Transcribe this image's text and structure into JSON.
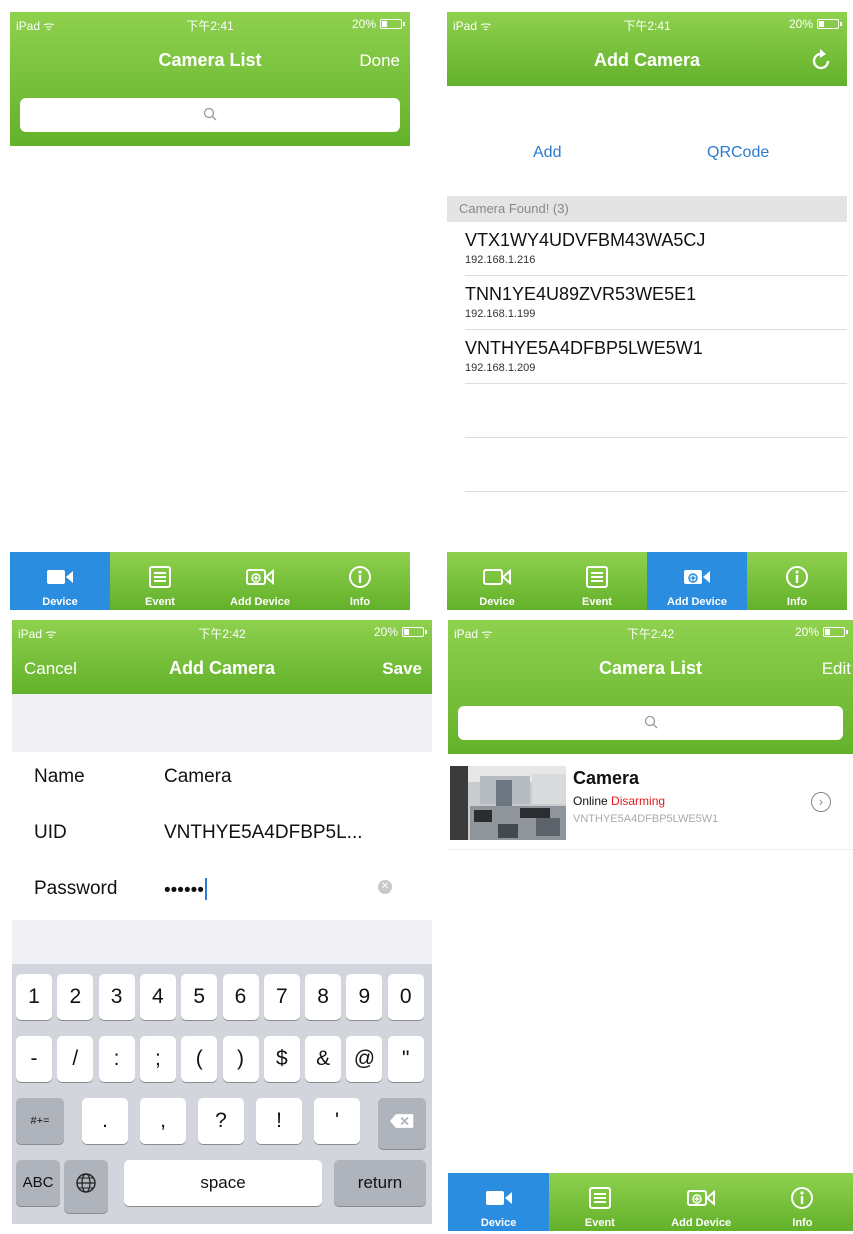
{
  "status": {
    "carrier_a": "iPad ᯤ",
    "carrier_b": "iPad ᯤ",
    "time_1": "下午2:41",
    "time_2": "下午2:42",
    "battery": "20%"
  },
  "screen1": {
    "title": "Camera List",
    "right_button": "Done"
  },
  "screen2": {
    "title": "Add Camera",
    "add_label": "Add",
    "qrcode_label": "QRCode",
    "section_header": "Camera Found! (3)",
    "cameras": [
      {
        "uid": "VTX1WY4UDVFBM43WA5CJ",
        "ip": "192.168.1.216"
      },
      {
        "uid": "TNN1YE4U89ZVR53WE5E1",
        "ip": "192.168.1.199"
      },
      {
        "uid": "VNTHYE5A4DFBP5LWE5W1",
        "ip": "192.168.1.209"
      }
    ]
  },
  "screen3": {
    "cancel": "Cancel",
    "title": "Add Camera",
    "save": "Save",
    "name_label": "Name",
    "name_value": "Camera",
    "uid_label": "UID",
    "uid_value": "VNTHYE5A4DFBP5L...",
    "password_label": "Password",
    "password_value": "••••••",
    "keyboard": {
      "row1": [
        "1",
        "2",
        "3",
        "4",
        "5",
        "6",
        "7",
        "8",
        "9",
        "0"
      ],
      "row2": [
        "-",
        "/",
        ":",
        ";",
        "(",
        ")",
        "$",
        "&",
        "@",
        "\""
      ],
      "row3_mode": "#+=",
      "row3": [
        ".",
        ",",
        "?",
        "!",
        "'"
      ],
      "abc": "ABC",
      "space": "space",
      "return": "return"
    }
  },
  "screen4": {
    "title": "Camera List",
    "right_button": "Edit",
    "camera": {
      "name": "Camera",
      "status_online": "Online",
      "status_mode": "Disarming",
      "uid": "VNTHYE5A4DFBP5LWE5W1"
    }
  },
  "tabs": {
    "device": "Device",
    "event": "Event",
    "add_device": "Add Device",
    "info": "Info"
  },
  "colors": {
    "header_green": "#6cbc2f",
    "active_tab_blue": "#2a8de0",
    "link_blue": "#2a7bd1",
    "disarming_red": "#e21b1b"
  }
}
